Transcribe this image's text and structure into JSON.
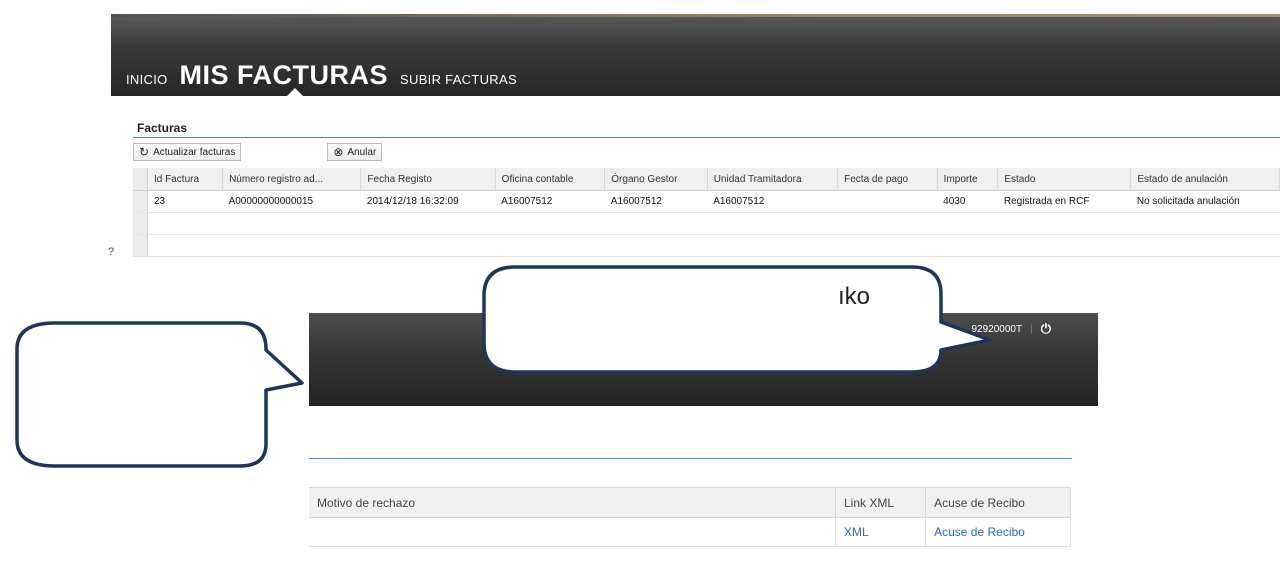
{
  "nav": {
    "inicio": "INICIO",
    "active": "MIS FACTURAS",
    "subir": "SUBIR FACTURAS"
  },
  "panel": {
    "title": "Facturas",
    "refresh_label": "Actualizar facturas",
    "anular_label": "Anular",
    "refresh_icon": "refresh-icon",
    "anular_icon": "cancel-circle-icon"
  },
  "table": {
    "headers": [
      "Id Factura",
      "Número registro ad...",
      "Fecha Registo",
      "Oficina contable",
      "Órgano Gestor",
      "Unidad Tramitadora",
      "Fecta de pago",
      "Importe",
      "Estado",
      "Estado de anulación"
    ],
    "rows": [
      [
        "23",
        "A00000000000015",
        "2014/12/18 16:32:09",
        "A16007512",
        "A16007512",
        "A16007512",
        "",
        "4030",
        "Registrada en RCF",
        "No solicitada anulación"
      ]
    ]
  },
  "side_glyph": "?",
  "lower": {
    "user": "92920000T",
    "separator": "|",
    "power_icon": "power-icon",
    "headers": [
      "Motivo de rechazo",
      "Link XML",
      "Acuse de Recibo"
    ],
    "row": [
      "",
      "XML",
      "Acuse de Recibo"
    ]
  },
  "callout_text": "ıko",
  "colors": {
    "accent": "#4a86c8",
    "link": "#2e6bb3",
    "callout_stroke": "#1f3557"
  }
}
